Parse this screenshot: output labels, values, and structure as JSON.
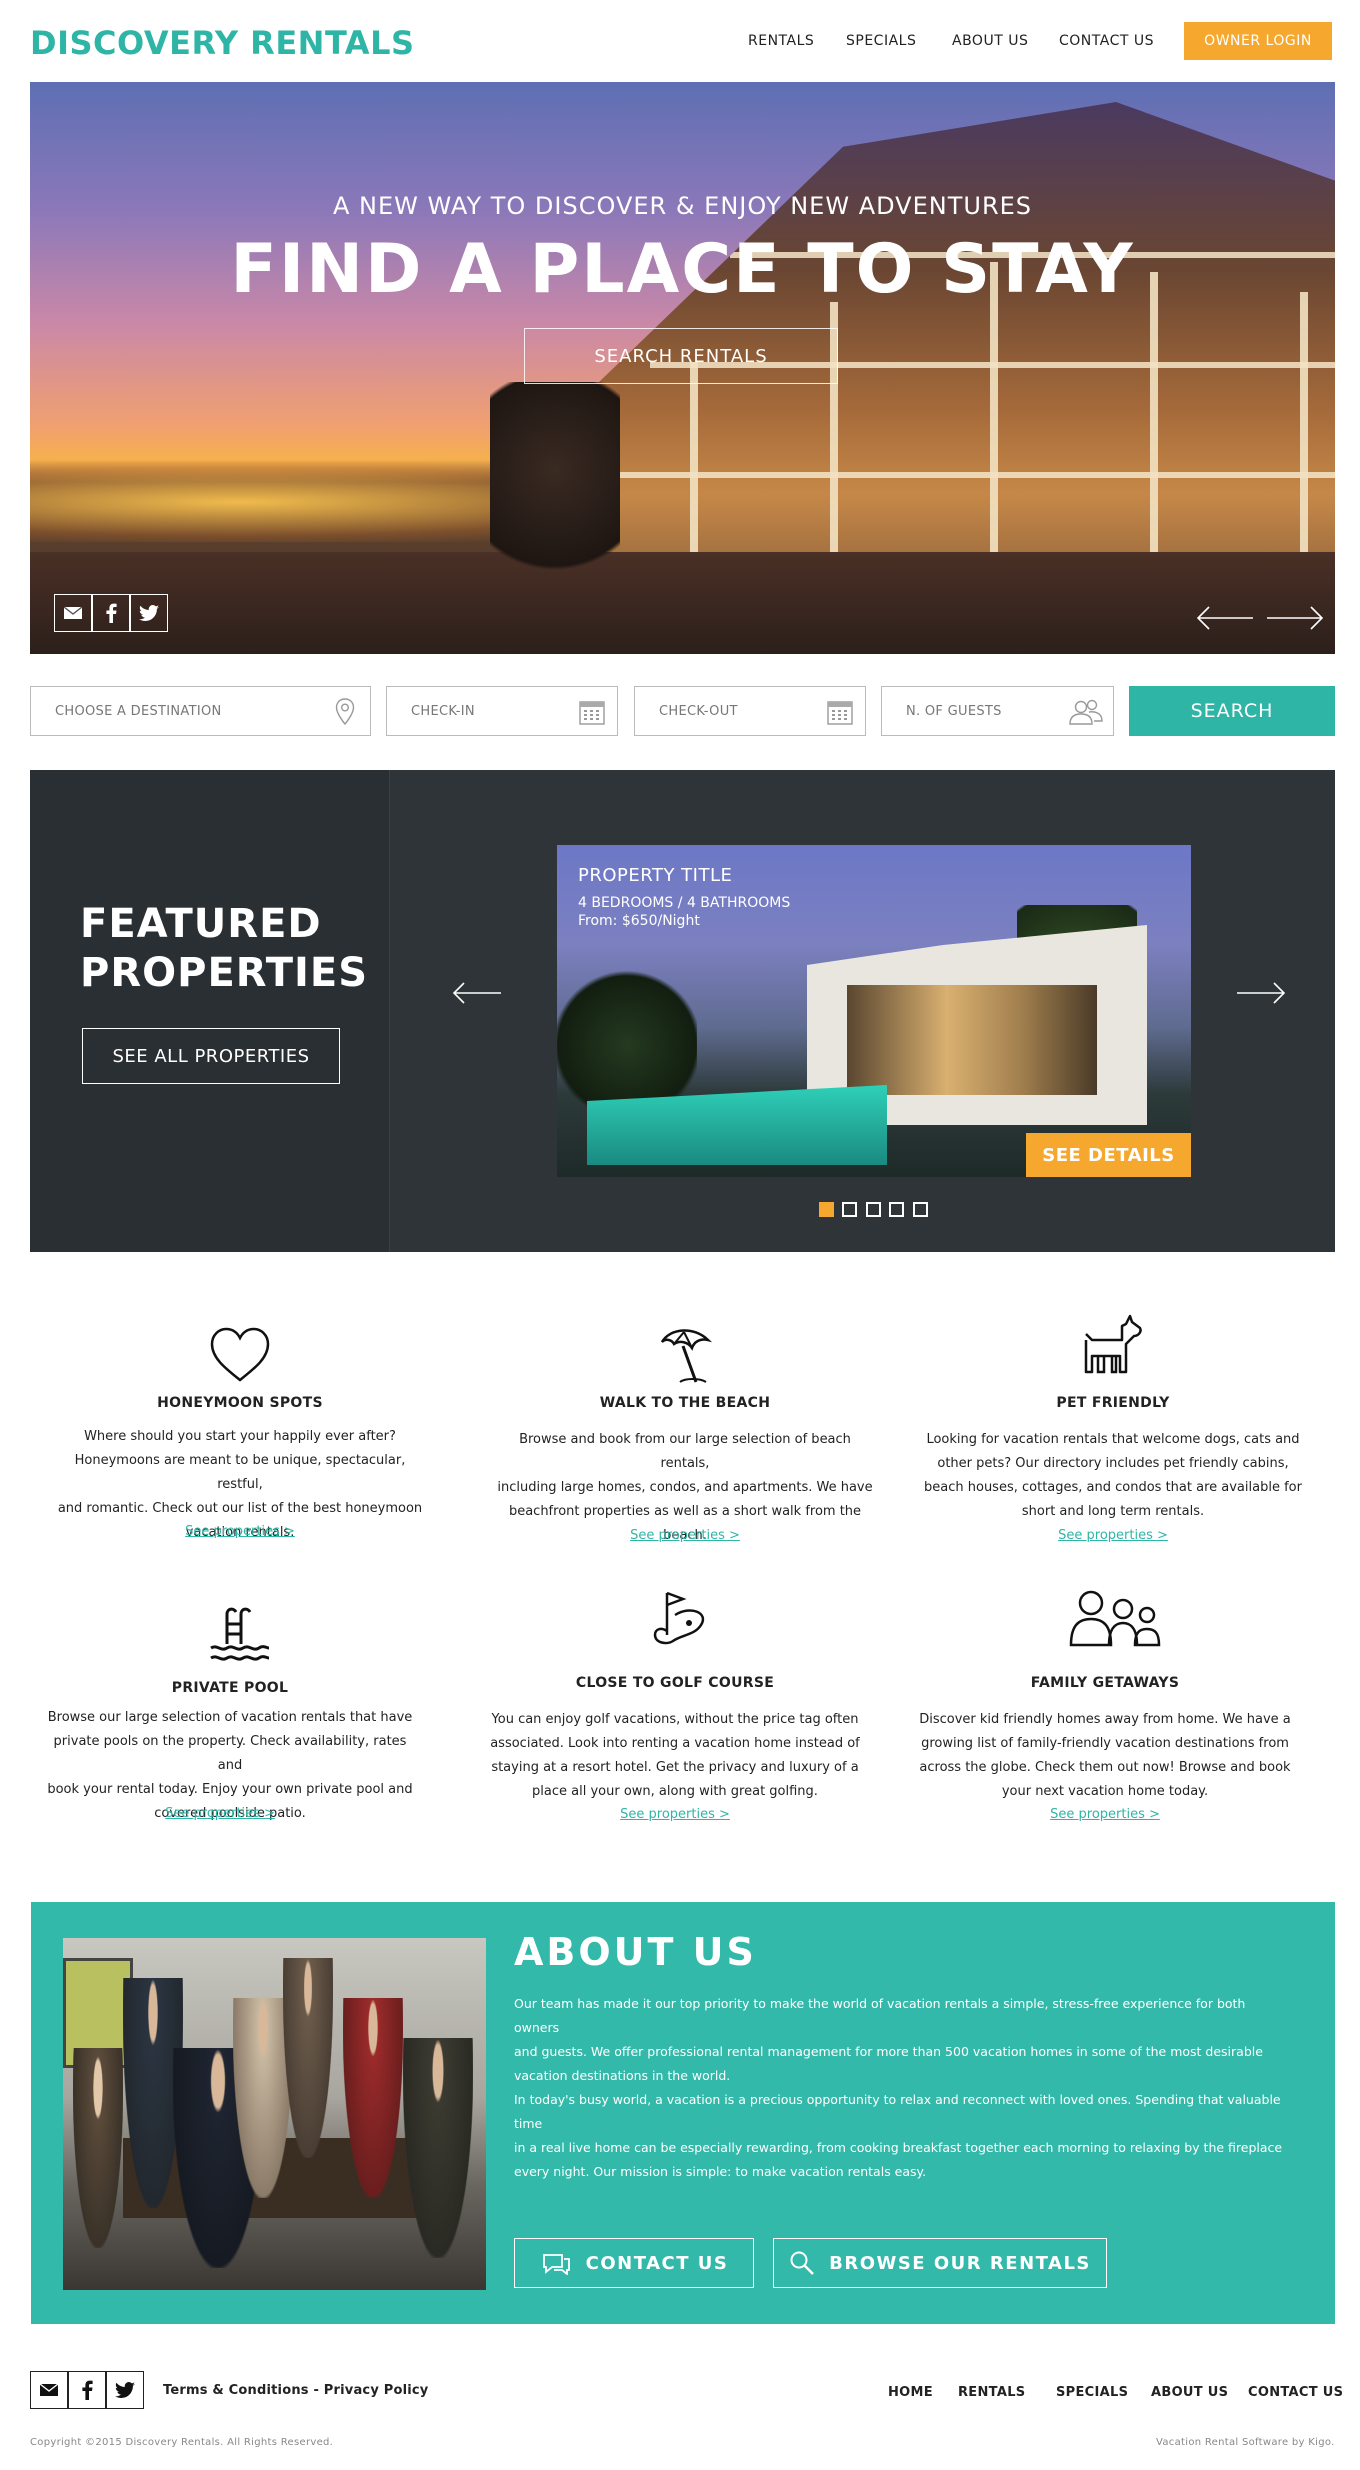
{
  "brand": {
    "logo": "DISCOVERY RENTALS",
    "accent": "#2fb5a6",
    "orange": "#f5a72e",
    "dark": "#2e3437"
  },
  "nav": {
    "items": [
      "RENTALS",
      "SPECIALS",
      "ABOUT US",
      "CONTACT US"
    ],
    "owner_login": "OWNER LOGIN"
  },
  "hero": {
    "subtitle": "A NEW WAY TO DISCOVER & ENJOY NEW ADVENTURES",
    "title": "FIND A PLACE TO STAY",
    "search_button": "SEARCH RENTALS",
    "social_icons": [
      "mail-icon",
      "facebook-icon",
      "twitter-icon"
    ]
  },
  "search": {
    "destination_placeholder": "CHOOSE A DESTINATION",
    "checkin_placeholder": "CHECK-IN",
    "checkout_placeholder": "CHECK-OUT",
    "guests_placeholder": "N. OF GUESTS",
    "button": "SEARCH"
  },
  "featured": {
    "title_line1": "FEATURED",
    "title_line2": "PROPERTIES",
    "see_all": "SEE ALL PROPERTIES",
    "property": {
      "title": "PROPERTY TITLE",
      "rooms": "4 BEDROOMS / 4 BATHROOMS",
      "price": "From: $650/Night",
      "details_button": "SEE DETAILS"
    },
    "slide_count": 5,
    "active_slide": 1
  },
  "features": [
    {
      "icon": "heart-icon",
      "title": "HONEYMOON SPOTS",
      "desc": [
        "Where should you start your happily ever after?",
        "Honeymoons are meant to be unique, spectacular, restful,",
        "and romantic. Check out our list of the best honeymoon",
        "vacation rentals."
      ],
      "link": "See properties >"
    },
    {
      "icon": "beach-umbrella-icon",
      "title": "WALK TO THE BEACH",
      "desc": [
        "Browse and book from our large selection of beach rentals,",
        "including large homes, condos, and apartments. We have",
        "beachfront properties as well as a short walk from the",
        "beach."
      ],
      "link": "See properties >"
    },
    {
      "icon": "dog-icon",
      "title": "PET FRIENDLY",
      "desc": [
        "Looking for vacation rentals that welcome dogs, cats and",
        "other pets? Our directory includes pet friendly cabins,",
        "beach houses, cottages, and condos that are available for",
        "short and long term rentals."
      ],
      "link": "See properties >"
    },
    {
      "icon": "pool-icon",
      "title": "PRIVATE POOL",
      "desc": [
        "Browse our large selection of vacation rentals that have",
        "private pools on the property. Check availability, rates and",
        "book your rental today. Enjoy your own private pool and",
        "covered poolside patio."
      ],
      "link": "See properties >"
    },
    {
      "icon": "golf-icon",
      "title": "CLOSE TO GOLF COURSE",
      "desc": [
        "You can enjoy golf vacations, without the price tag often",
        "associated. Look into renting a vacation home instead of",
        "staying at a resort hotel. Get the privacy and luxury of a",
        "place all your own, along with great golfing."
      ],
      "link": "See properties >"
    },
    {
      "icon": "family-icon",
      "title": "FAMILY GETAWAYS",
      "desc": [
        "Discover kid friendly homes away from home. We have a",
        "growing list of family-friendly vacation destinations from",
        "across the globe. Check them out now! Browse and book",
        "your next vacation home today."
      ],
      "link": "See properties >"
    }
  ],
  "about": {
    "title": "ABOUT US",
    "p1": [
      "Our team has made it our top priority to make the world of vacation rentals a simple, stress-free experience for both owners",
      "and guests. We offer professional rental management for more than 500 vacation homes in some of the most desirable",
      "vacation destinations in the world."
    ],
    "p2": [
      "In today's busy world, a vacation is a precious opportunity to relax and reconnect with loved ones. Spending that valuable time",
      "in a real live home can be especially rewarding, from cooking breakfast together each morning to relaxing by the fireplace",
      "every night. Our mission is simple: to make vacation rentals easy."
    ],
    "contact_button": "CONTACT US",
    "browse_button": "BROWSE OUR RENTALS"
  },
  "footer": {
    "terms": "Terms & Conditions - Privacy Policy",
    "nav": [
      "HOME",
      "RENTALS",
      "SPECIALS",
      "ABOUT US",
      "CONTACT US"
    ],
    "copyright": "Copyright ©2015 Discovery Rentals. All Rights Reserved.",
    "credit": "Vacation Rental Software by Kigo."
  }
}
